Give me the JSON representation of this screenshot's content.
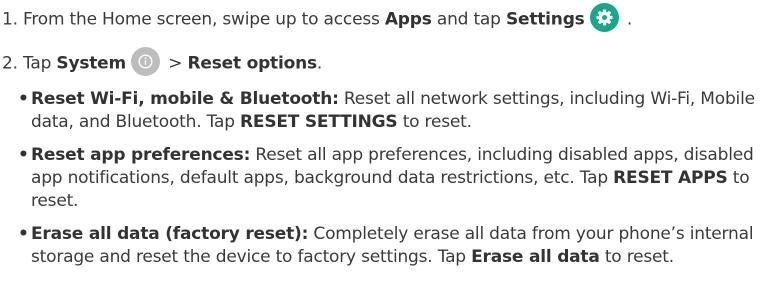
{
  "step1": {
    "prefix": "1. From the Home screen, swipe up to access ",
    "apps": "Apps",
    "mid": " and tap ",
    "settings": "Settings",
    "suffix": " ."
  },
  "step2": {
    "prefix": "2. Tap ",
    "system": "System",
    "sep": " > ",
    "reset_options": "Reset options",
    "suffix": "."
  },
  "bullets": [
    {
      "title": "Reset Wi-Fi, mobile & Bluetooth:",
      "text1": " Reset all network settings, including Wi-Fi, Mobile data, and Bluetooth. Tap ",
      "strong": "RESET SETTINGS",
      "text2": " to reset."
    },
    {
      "title": "Reset app preferences:",
      "text1": " Reset all app preferences, including disabled apps, disabled app notifications, default apps, background data restrictions, etc. Tap ",
      "strong": "RESET APPS",
      "text2": " to reset."
    },
    {
      "title": "Erase all data (factory reset):",
      "text1": " Completely erase all data from your phone’s internal storage and reset the device to factory settings. Tap ",
      "strong": "Erase all data",
      "text2": " to reset."
    }
  ],
  "icons": {
    "settings_icon": "gear-icon",
    "settings_color": "#1aa689",
    "system_icon": "info-icon",
    "system_color": "#bdbdbd"
  }
}
